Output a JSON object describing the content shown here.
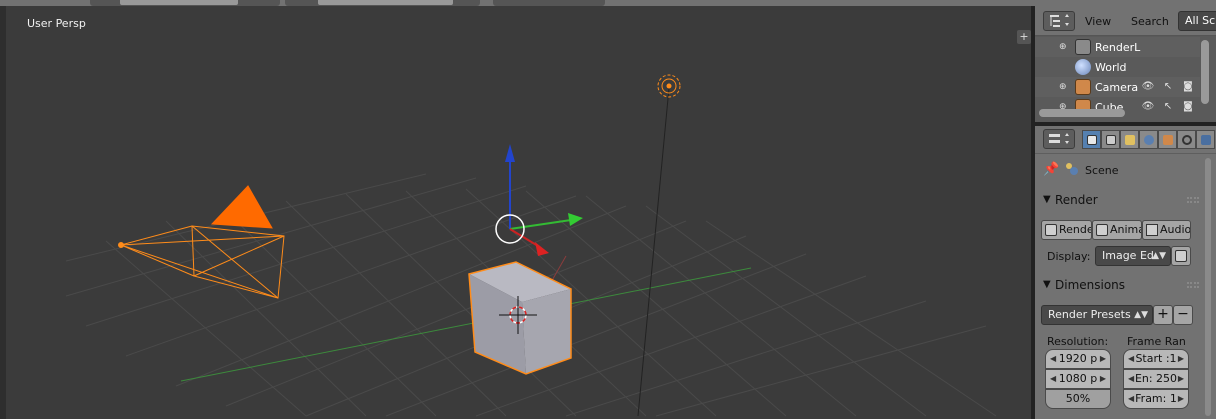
{
  "viewport": {
    "view_label": "User Persp",
    "plus_label": "+"
  },
  "outliner": {
    "menus": {
      "view": "View",
      "search": "Search"
    },
    "display_mode": "All Sc",
    "items": [
      {
        "label": "RenderL",
        "icon": "render-layers-icon"
      },
      {
        "label": "World",
        "icon": "world-icon"
      },
      {
        "label": "Camera",
        "icon": "camera-icon"
      },
      {
        "label": "Cube",
        "icon": "cube-icon"
      }
    ]
  },
  "properties": {
    "scene_label": "Scene",
    "render_panel": {
      "title": "Render",
      "buttons": [
        "Rende",
        "Anima",
        "Audio"
      ],
      "display_label": "Display:",
      "display_value": "Image Ed"
    },
    "dimensions_panel": {
      "title": "Dimensions",
      "presets": "Render Presets",
      "resolution_label": "Resolution:",
      "frame_range_label": "Frame Ran",
      "res_x": "1920 p",
      "res_y": "1080 p",
      "res_pct": "50%",
      "start": "Start :1",
      "end": "En: 250",
      "step": "Fram: 1"
    }
  },
  "colors": {
    "selection_orange": "#ff8c1a",
    "cube_face": "#a9a9b0",
    "axis_x": "#cc2222",
    "axis_y": "#33bb33",
    "axis_z": "#2244cc"
  }
}
